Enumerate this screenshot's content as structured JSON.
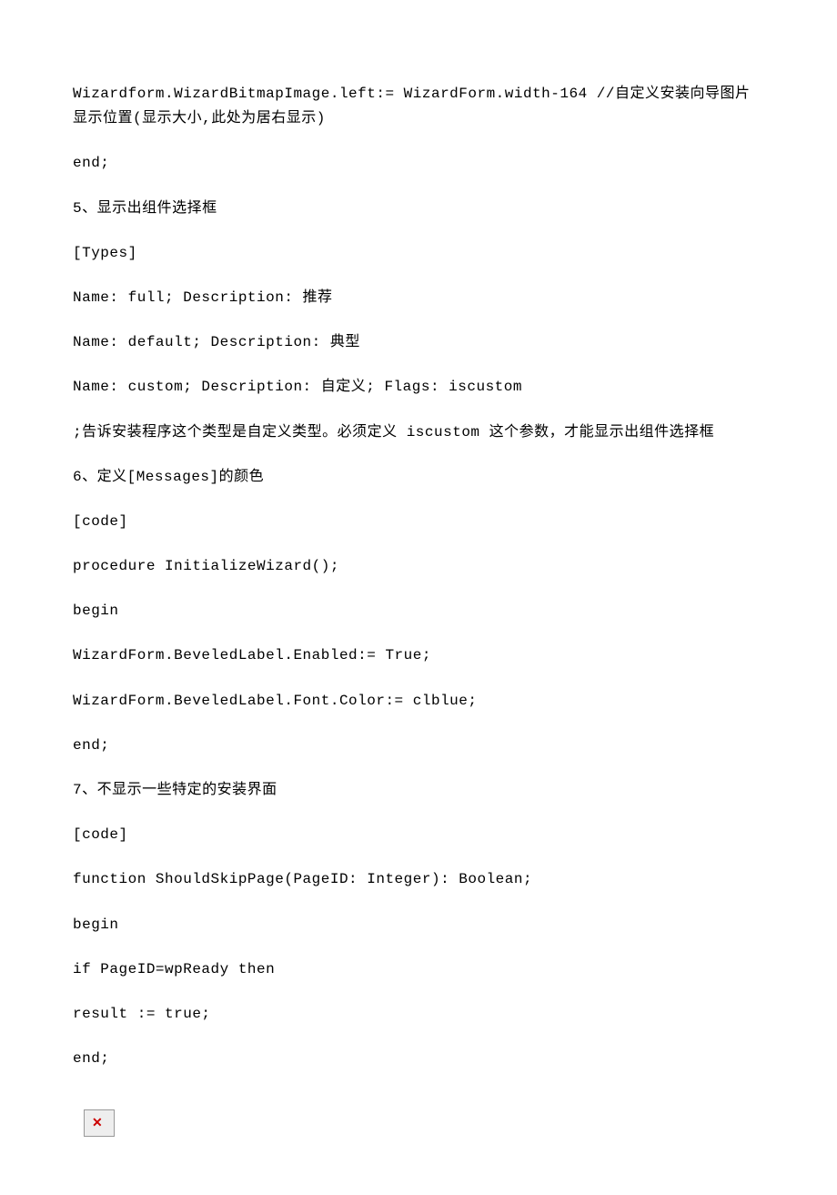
{
  "paragraphs": [
    "Wizardform.WizardBitmapImage.left:= WizardForm.width-164 //自定义安装向导图片显示位置(显示大小,此处为居右显示)",
    "end;",
    "5、显示出组件选择框",
    "[Types]",
    "Name: full; Description: 推荐",
    "Name: default; Description: 典型",
    "Name: custom; Description: 自定义; Flags: iscustom",
    ";告诉安装程序这个类型是自定义类型。必须定义 iscustom 这个参数，才能显示出组件选择框",
    "6、定义[Messages]的颜色",
    "[code]",
    "procedure InitializeWizard();",
    "begin",
    "WizardForm.BeveledLabel.Enabled:= True;",
    "WizardForm.BeveledLabel.Font.Color:= clblue;",
    "end;",
    "7、不显示一些特定的安装界面",
    "[code]",
    "function ShouldSkipPage(PageID: Integer): Boolean;",
    "begin",
    "if PageID=wpReady then",
    "result := true;",
    "end;"
  ],
  "broken_image_symbol": "✕"
}
